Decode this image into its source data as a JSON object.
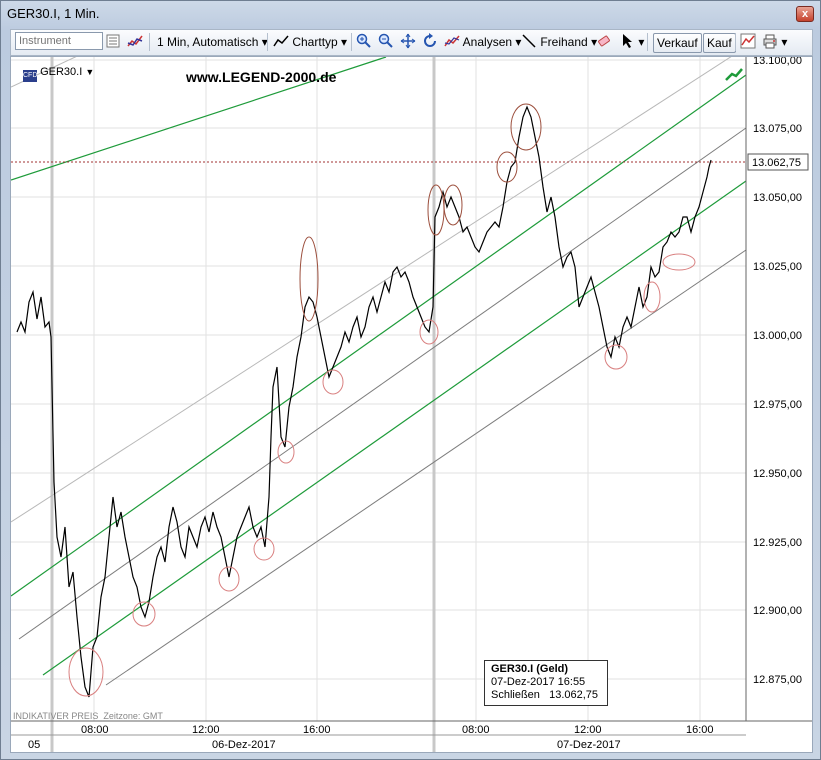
{
  "window": {
    "title": "GER30.I, 1 Min.",
    "close_label": "x"
  },
  "toolbar": {
    "instrument_placeholder": "Instrument",
    "interval_label": "1 Min,",
    "scale_label": "Automatisch",
    "charttype_label": "Charttyp",
    "analysen_label": "Analysen",
    "freihand_label": "Freihand",
    "verkauf_label": "Verkauf",
    "kauf_label": "Kauf"
  },
  "chart": {
    "symbol_label": "GER30.I",
    "watermark": "www.LEGEND-2000.de",
    "indicative_label": "INDIKATIVER PREIS",
    "timezone_label": "Zeitzone: GMT",
    "current_price_label": "13.062,75",
    "price_ticks": [
      "13.100,00",
      "13.075,00",
      "13.050,00",
      "13.025,00",
      "13.000,00",
      "12.975,00",
      "12.950,00",
      "12.925,00",
      "12.900,00",
      "12.875,00"
    ],
    "time_ticks": [
      "08:00",
      "12:00",
      "16:00",
      "08:00",
      "12:00",
      "16:00"
    ],
    "date_labels": [
      "05",
      "06-Dez-2017",
      "07-Dez-2017"
    ]
  },
  "info_box": {
    "title": "GER30.I (Geld)",
    "date_line": "07-Dez-2017 16:55",
    "close_label": "Schließen",
    "close_value": "13.062,75"
  },
  "colors": {
    "price_line": "#000000",
    "channel_green": "#1e9b3a",
    "channel_gray": "#808080",
    "marker_circles": "#d98080",
    "current_price_line": "#a03030"
  }
}
